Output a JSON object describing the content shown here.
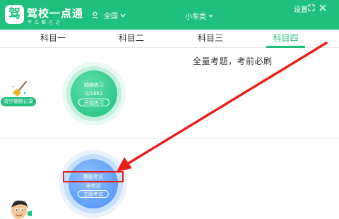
{
  "header": {
    "logo_char": "驾",
    "app_name": "驾校一点通",
    "slogan": "学车都在这",
    "region": "全国",
    "car_type": "小车类",
    "settings": "设置"
  },
  "tabs": [
    {
      "label": "科目一"
    },
    {
      "label": "科目二"
    },
    {
      "label": "科目三"
    },
    {
      "label": "科目四"
    }
  ],
  "main": {
    "headline": "全量考题，考前必刷",
    "clear_records": "清空做题记录",
    "practice": {
      "title": "顺序练习",
      "progress": "0/1661",
      "button": "开始练习"
    },
    "mock_exam": {
      "title": "模拟考试",
      "status": "未考试",
      "button": "立即考试"
    }
  },
  "colors": {
    "brand_green": "#1fbf7c",
    "exam_blue": "#4b8ff0",
    "annotation_red": "#e8201c"
  },
  "icons": {
    "region": "location-icon",
    "dropdown": "chevron-down-icon",
    "pin": "pin-icon",
    "close": "close-icon",
    "clear": "broom-icon",
    "avatar": "cartoon-avatar"
  }
}
